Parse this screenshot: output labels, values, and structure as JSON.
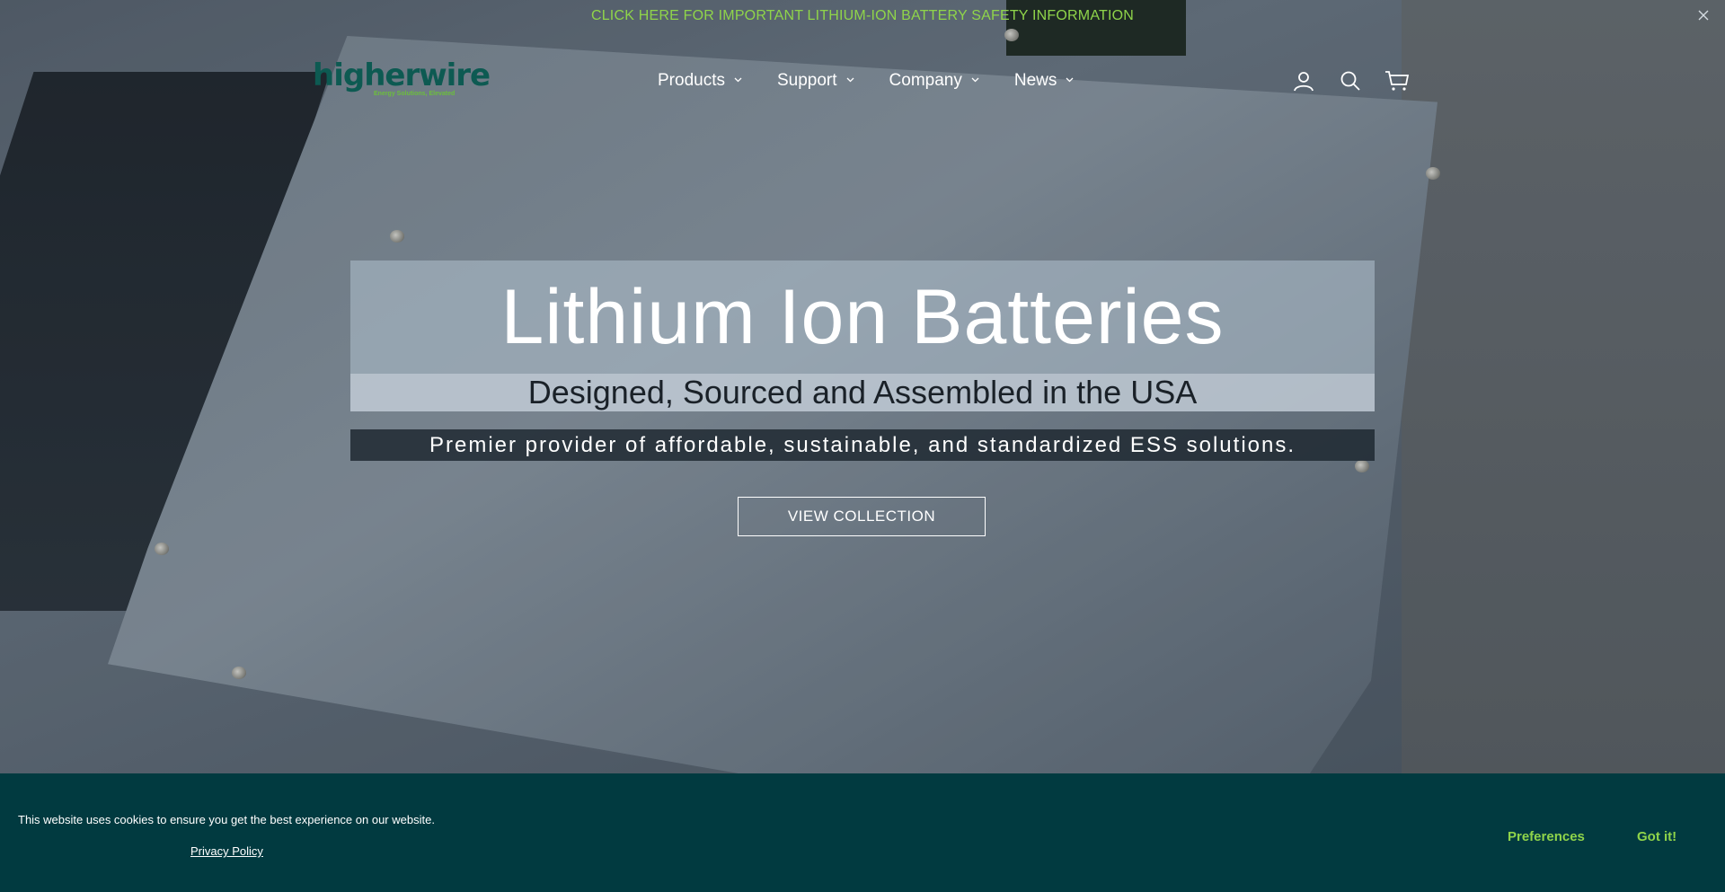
{
  "announcement": {
    "text": "CLICK HERE FOR IMPORTANT LITHIUM-ION BATTERY SAFETY INFORMATION",
    "close_icon": "close-icon",
    "color": "#8fd44a"
  },
  "header": {
    "logo": {
      "wordmark": "higherwire",
      "tagline": "Energy Solutions, Elevated"
    },
    "nav": [
      {
        "label": "Products",
        "icon": "chevron-down-icon"
      },
      {
        "label": "Support",
        "icon": "chevron-down-icon"
      },
      {
        "label": "Company",
        "icon": "chevron-down-icon"
      },
      {
        "label": "News",
        "icon": "chevron-down-icon"
      }
    ],
    "icons": [
      "account-icon",
      "search-icon",
      "cart-icon"
    ]
  },
  "hero": {
    "title": "Lithium Ion Batteries",
    "subtitle": "Designed, Sourced and Assembled in the USA",
    "tagline": "Premier provider of affordable, sustainable, and standardized ESS solutions.",
    "button_label": "VIEW COLLECTION"
  },
  "cookie_banner": {
    "message": "This website uses cookies to ensure you get the best experience on our website.",
    "privacy_link": "Privacy Policy",
    "preferences_label": "Preferences",
    "accept_label": "Got it!",
    "background": "#013a40",
    "accent": "#8fd44a"
  }
}
